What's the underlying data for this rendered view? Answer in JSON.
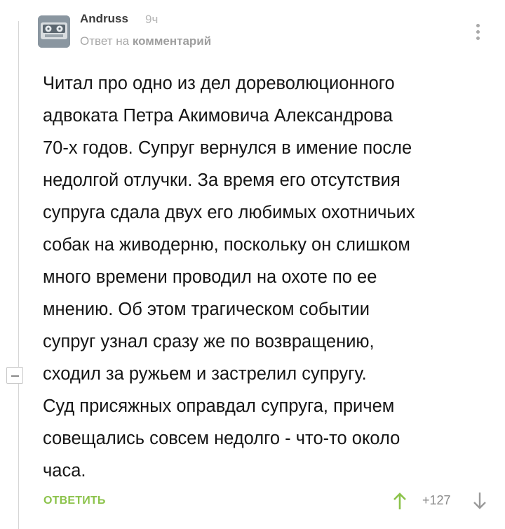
{
  "comment": {
    "author": "Andruss",
    "time": "9ч",
    "reply_prefix": "Ответ на",
    "reply_link": "комментарий",
    "text": "Читал про одно из дел дореволюционного\nадвоката Петра Акимовича Александрова\n70-х годов. Супруг вернулся в имение после\nнедолгой отлучки. За время его отсутствия\nсупруга сдала двух его любимых охотничьих\nсобак на живодерню, поскольку он слишком\nмного времени проводил на охоте по ее\nмнению. Об этом трагическом событии\nсупруг узнал сразу же по возвращению,\nсходил за ружьем и застрелил супругу.\nСуд присяжных оправдал супруга, причем\nсовещались совсем недолго - что-то около\nчаса.",
    "reply_button": "ОТВЕТИТЬ",
    "rating": "+127"
  },
  "colors": {
    "accent_green": "#8cc34b",
    "muted_text": "#a8a8a8"
  },
  "icons": {
    "menu": "kebab-menu-icon",
    "upvote": "arrow-up-icon",
    "downvote": "arrow-down-icon",
    "collapse": "minus-icon"
  }
}
